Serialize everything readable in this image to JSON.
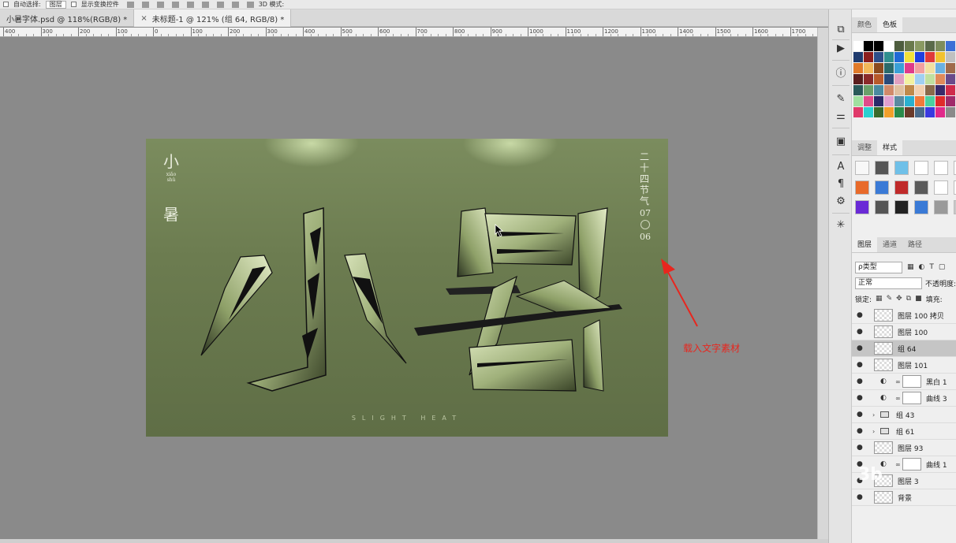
{
  "options_bar": {
    "auto_select_label": "自动选择:",
    "auto_select_value": "图层",
    "show_transform_label": "显示变换控件",
    "mode_3d_label": "3D 模式:"
  },
  "tabs": [
    {
      "label": "小暑字体.psd @ 118%(RGB/8) *",
      "active": false
    },
    {
      "label": "未标题-1 @ 121% (组 64, RGB/8) *",
      "active": true
    }
  ],
  "ruler_labels": [
    "400",
    "300",
    "200",
    "100",
    "0",
    "100",
    "200",
    "300",
    "400",
    "500",
    "600",
    "700",
    "800",
    "900",
    "1000",
    "1100",
    "1200",
    "1300",
    "1400",
    "1500",
    "1600",
    "1700"
  ],
  "artwork": {
    "left_title_top": "小",
    "left_pinyin": "xiǎo shǔ",
    "left_title_bottom": "暑",
    "right_term": "二十四节气",
    "right_date_month": "07",
    "right_date_day": "06",
    "bottom_caption": "SLIGHT HEAT",
    "accent_color": "#6c7c50"
  },
  "annotation": {
    "text": "载入文字素材",
    "color": "#e8261e"
  },
  "dock_icons": [
    "history-icon",
    "play-icon",
    "info-icon",
    "brush-icon",
    "adjust-icon",
    "folder-icon",
    "character-icon",
    "paragraph-icon",
    "plugin-icon",
    "burst-icon"
  ],
  "panels": {
    "color_tabs": [
      "颜色",
      "色板"
    ],
    "adjust_tabs": [
      "调整",
      "样式"
    ],
    "layers_tabs": [
      "图层",
      "通道",
      "路径"
    ],
    "filter_label": "ρ类型",
    "blend_mode": "正常",
    "opacity_label": "不透明度:",
    "lock_label": "锁定:",
    "fill_label": "填充:"
  },
  "swatch_colors": [
    "#ffffff",
    "#000000",
    "#000000",
    "#ffffff",
    "#4e5d3e",
    "#6a7a4c",
    "#8a9a62",
    "#5a6a4a",
    "#7d8d5d",
    "#3c6fd6",
    "#1f3b6e",
    "#8b1e1e",
    "#2d4f8a",
    "#2f8f8f",
    "#1f6ad6",
    "#f2e03a",
    "#1f3fe0",
    "#e03a3a",
    "#f2c230",
    "#c0c0c0",
    "#e07a2a",
    "#f2b85a",
    "#8b4a1e",
    "#2a6a6a",
    "#3aa0d6",
    "#e03a8a",
    "#f2a0a0",
    "#f2e0a0",
    "#6ab0e0",
    "#a06a4a",
    "#5a1e1e",
    "#8b2a2a",
    "#b85a2a",
    "#2a4a7a",
    "#e0a0c0",
    "#f2f2a0",
    "#a0d0f2",
    "#c0e0a0",
    "#e08a5a",
    "#6a4a8a",
    "#2a5a5a",
    "#6aa06a",
    "#4a8aa0",
    "#d08a6a",
    "#e0c0a0",
    "#c08a4a",
    "#f2d0b0",
    "#8a6a4a",
    "#3a2a6a",
    "#d02a4a",
    "#a0e0a0",
    "#e04a8a",
    "#2a2a6a",
    "#e0a0d0",
    "#5a8aa0",
    "#2ab0d0",
    "#f27a3a",
    "#4ad0a0",
    "#e02a2a",
    "#a02a6a",
    "#e03a6a",
    "#2ad0d0",
    "#3a6a2a",
    "#f2a02a",
    "#2a8a4a",
    "#6a3a2a",
    "#4a6a8a",
    "#3a3ae0",
    "#e02a8a",
    "#8a8a8a"
  ],
  "style_swatches": [
    "#f7f7f7",
    "#555555",
    "#6fc0e8",
    "#ffffff",
    "#ffffff",
    "#ffffff",
    "#e86a2a",
    "#3a7ad6",
    "#c02a2a",
    "#5a5a5a",
    "#ffffff",
    "#ffffff",
    "#6a2ad6",
    "#555555",
    "#222222",
    "#3a7ad6",
    "#9a9a9a",
    "#c8c8c8"
  ],
  "layers": [
    {
      "name": "图层 100 拷贝",
      "kind": "pixel",
      "selected": false
    },
    {
      "name": "图层 100",
      "kind": "pixel",
      "selected": false
    },
    {
      "name": "组 64",
      "kind": "smart",
      "selected": true
    },
    {
      "name": "图层 101",
      "kind": "pixel",
      "selected": false
    },
    {
      "name": "黑白 1",
      "kind": "adjustment",
      "selected": false
    },
    {
      "name": "曲线 3",
      "kind": "adjustment",
      "selected": false
    },
    {
      "name": "组 43",
      "kind": "group",
      "selected": false
    },
    {
      "name": "组 61",
      "kind": "group",
      "selected": false
    },
    {
      "name": "图层 93",
      "kind": "pixel",
      "selected": false
    },
    {
      "name": "曲线 1",
      "kind": "adjustment",
      "selected": false
    },
    {
      "name": "图层 3",
      "kind": "pixel",
      "selected": false
    },
    {
      "name": "背景",
      "kind": "pixel",
      "selected": false
    }
  ],
  "watermark": "3b"
}
